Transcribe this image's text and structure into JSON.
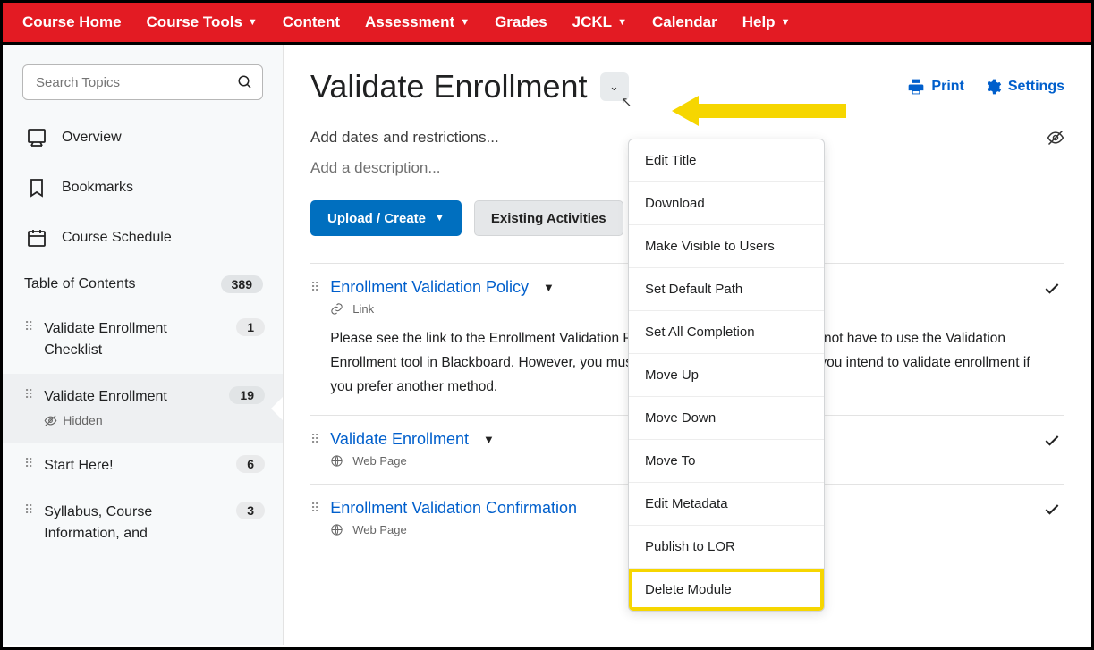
{
  "nav": {
    "items": [
      {
        "label": "Course Home",
        "dropdown": false
      },
      {
        "label": "Course Tools",
        "dropdown": true
      },
      {
        "label": "Content",
        "dropdown": false
      },
      {
        "label": "Assessment",
        "dropdown": true
      },
      {
        "label": "Grades",
        "dropdown": false
      },
      {
        "label": "JCKL",
        "dropdown": true
      },
      {
        "label": "Calendar",
        "dropdown": false
      },
      {
        "label": "Help",
        "dropdown": true
      }
    ]
  },
  "sidebar": {
    "search_placeholder": "Search Topics",
    "links": [
      {
        "label": "Overview",
        "icon": "overview"
      },
      {
        "label": "Bookmarks",
        "icon": "bookmark"
      },
      {
        "label": "Course Schedule",
        "icon": "calendar"
      }
    ],
    "toc_label": "Table of Contents",
    "toc_count": "389",
    "toc_items": [
      {
        "label": "Validate Enrollment Checklist",
        "count": "1",
        "hidden": false
      },
      {
        "label": "Validate Enrollment",
        "count": "19",
        "hidden": true,
        "hidden_label": "Hidden",
        "active": true
      },
      {
        "label": "Start Here!",
        "count": "6",
        "hidden": false
      },
      {
        "label": "Syllabus, Course Information, and",
        "count": "3",
        "hidden": false
      }
    ]
  },
  "main": {
    "title": "Validate Enrollment",
    "actions": {
      "print": "Print",
      "settings": "Settings"
    },
    "dates_text": "Add dates and restrictions...",
    "desc_text": "Add a description...",
    "buttons": {
      "upload": "Upload / Create",
      "existing": "Existing Activities"
    },
    "items": [
      {
        "title": "Enrollment Validation Policy",
        "type_icon": "link",
        "type_label": "Link",
        "desc": "Please see the link to the Enrollment Validation Policy.  Notice that instructors do not have to use the Validation Enrollment tool in Blackboard.  However, you must explain to your students how you intend to validate enrollment if you prefer another method."
      },
      {
        "title": "Validate Enrollment",
        "type_icon": "web",
        "type_label": "Web Page",
        "desc": ""
      },
      {
        "title": "Enrollment Validation Confirmation",
        "type_icon": "web",
        "type_label": "Web Page",
        "desc": ""
      }
    ]
  },
  "dropdown": {
    "items": [
      "Edit Title",
      "Download",
      "Make Visible to Users",
      "Set Default Path",
      "Set All Completion",
      "Move Up",
      "Move Down",
      "Move To",
      "Edit Metadata",
      "Publish to LOR",
      "Delete Module"
    ],
    "highlight_index": 10
  }
}
